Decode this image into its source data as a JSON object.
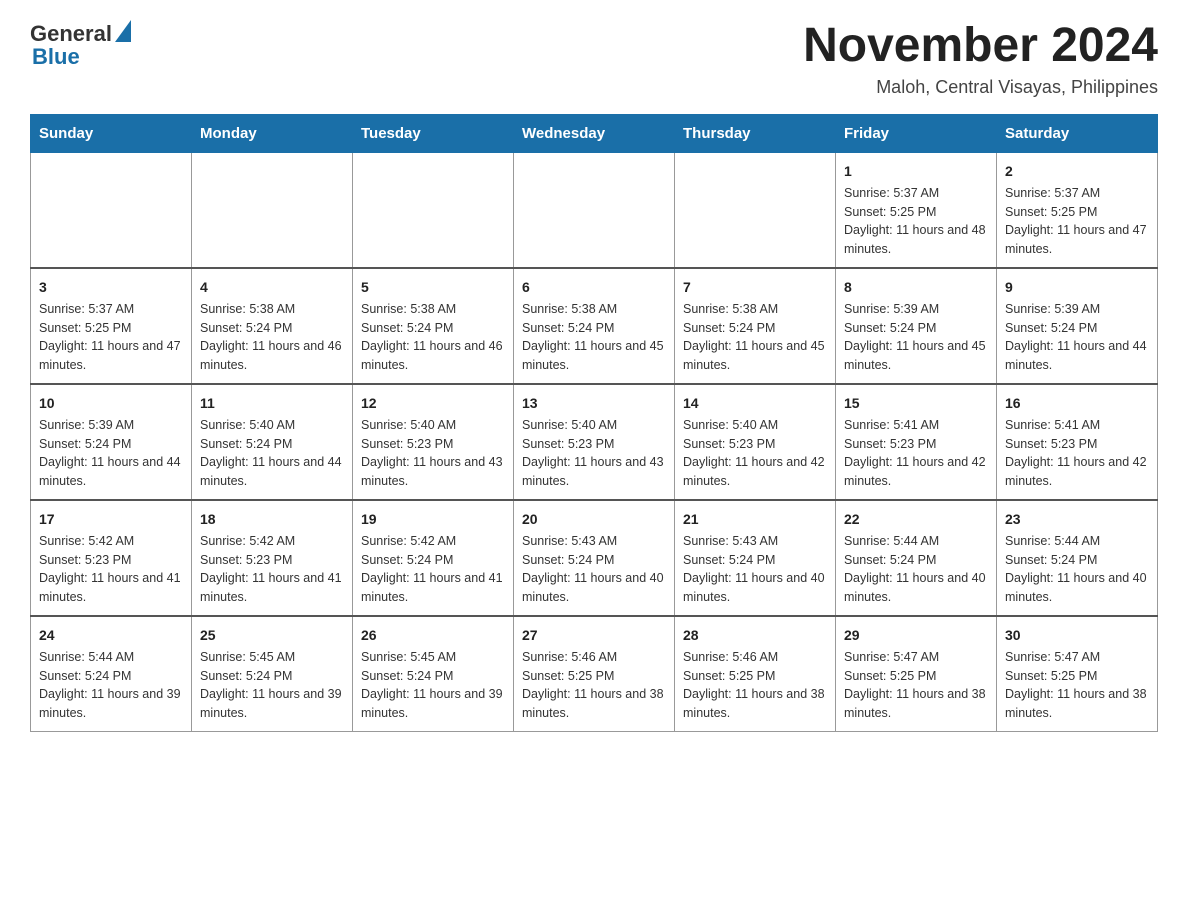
{
  "logo": {
    "general": "General",
    "blue": "Blue"
  },
  "title": "November 2024",
  "location": "Maloh, Central Visayas, Philippines",
  "days_of_week": [
    "Sunday",
    "Monday",
    "Tuesday",
    "Wednesday",
    "Thursday",
    "Friday",
    "Saturday"
  ],
  "weeks": [
    [
      {
        "day": "",
        "sunrise": "",
        "sunset": "",
        "daylight": ""
      },
      {
        "day": "",
        "sunrise": "",
        "sunset": "",
        "daylight": ""
      },
      {
        "day": "",
        "sunrise": "",
        "sunset": "",
        "daylight": ""
      },
      {
        "day": "",
        "sunrise": "",
        "sunset": "",
        "daylight": ""
      },
      {
        "day": "",
        "sunrise": "",
        "sunset": "",
        "daylight": ""
      },
      {
        "day": "1",
        "sunrise": "Sunrise: 5:37 AM",
        "sunset": "Sunset: 5:25 PM",
        "daylight": "Daylight: 11 hours and 48 minutes."
      },
      {
        "day": "2",
        "sunrise": "Sunrise: 5:37 AM",
        "sunset": "Sunset: 5:25 PM",
        "daylight": "Daylight: 11 hours and 47 minutes."
      }
    ],
    [
      {
        "day": "3",
        "sunrise": "Sunrise: 5:37 AM",
        "sunset": "Sunset: 5:25 PM",
        "daylight": "Daylight: 11 hours and 47 minutes."
      },
      {
        "day": "4",
        "sunrise": "Sunrise: 5:38 AM",
        "sunset": "Sunset: 5:24 PM",
        "daylight": "Daylight: 11 hours and 46 minutes."
      },
      {
        "day": "5",
        "sunrise": "Sunrise: 5:38 AM",
        "sunset": "Sunset: 5:24 PM",
        "daylight": "Daylight: 11 hours and 46 minutes."
      },
      {
        "day": "6",
        "sunrise": "Sunrise: 5:38 AM",
        "sunset": "Sunset: 5:24 PM",
        "daylight": "Daylight: 11 hours and 45 minutes."
      },
      {
        "day": "7",
        "sunrise": "Sunrise: 5:38 AM",
        "sunset": "Sunset: 5:24 PM",
        "daylight": "Daylight: 11 hours and 45 minutes."
      },
      {
        "day": "8",
        "sunrise": "Sunrise: 5:39 AM",
        "sunset": "Sunset: 5:24 PM",
        "daylight": "Daylight: 11 hours and 45 minutes."
      },
      {
        "day": "9",
        "sunrise": "Sunrise: 5:39 AM",
        "sunset": "Sunset: 5:24 PM",
        "daylight": "Daylight: 11 hours and 44 minutes."
      }
    ],
    [
      {
        "day": "10",
        "sunrise": "Sunrise: 5:39 AM",
        "sunset": "Sunset: 5:24 PM",
        "daylight": "Daylight: 11 hours and 44 minutes."
      },
      {
        "day": "11",
        "sunrise": "Sunrise: 5:40 AM",
        "sunset": "Sunset: 5:24 PM",
        "daylight": "Daylight: 11 hours and 44 minutes."
      },
      {
        "day": "12",
        "sunrise": "Sunrise: 5:40 AM",
        "sunset": "Sunset: 5:23 PM",
        "daylight": "Daylight: 11 hours and 43 minutes."
      },
      {
        "day": "13",
        "sunrise": "Sunrise: 5:40 AM",
        "sunset": "Sunset: 5:23 PM",
        "daylight": "Daylight: 11 hours and 43 minutes."
      },
      {
        "day": "14",
        "sunrise": "Sunrise: 5:40 AM",
        "sunset": "Sunset: 5:23 PM",
        "daylight": "Daylight: 11 hours and 42 minutes."
      },
      {
        "day": "15",
        "sunrise": "Sunrise: 5:41 AM",
        "sunset": "Sunset: 5:23 PM",
        "daylight": "Daylight: 11 hours and 42 minutes."
      },
      {
        "day": "16",
        "sunrise": "Sunrise: 5:41 AM",
        "sunset": "Sunset: 5:23 PM",
        "daylight": "Daylight: 11 hours and 42 minutes."
      }
    ],
    [
      {
        "day": "17",
        "sunrise": "Sunrise: 5:42 AM",
        "sunset": "Sunset: 5:23 PM",
        "daylight": "Daylight: 11 hours and 41 minutes."
      },
      {
        "day": "18",
        "sunrise": "Sunrise: 5:42 AM",
        "sunset": "Sunset: 5:23 PM",
        "daylight": "Daylight: 11 hours and 41 minutes."
      },
      {
        "day": "19",
        "sunrise": "Sunrise: 5:42 AM",
        "sunset": "Sunset: 5:24 PM",
        "daylight": "Daylight: 11 hours and 41 minutes."
      },
      {
        "day": "20",
        "sunrise": "Sunrise: 5:43 AM",
        "sunset": "Sunset: 5:24 PM",
        "daylight": "Daylight: 11 hours and 40 minutes."
      },
      {
        "day": "21",
        "sunrise": "Sunrise: 5:43 AM",
        "sunset": "Sunset: 5:24 PM",
        "daylight": "Daylight: 11 hours and 40 minutes."
      },
      {
        "day": "22",
        "sunrise": "Sunrise: 5:44 AM",
        "sunset": "Sunset: 5:24 PM",
        "daylight": "Daylight: 11 hours and 40 minutes."
      },
      {
        "day": "23",
        "sunrise": "Sunrise: 5:44 AM",
        "sunset": "Sunset: 5:24 PM",
        "daylight": "Daylight: 11 hours and 40 minutes."
      }
    ],
    [
      {
        "day": "24",
        "sunrise": "Sunrise: 5:44 AM",
        "sunset": "Sunset: 5:24 PM",
        "daylight": "Daylight: 11 hours and 39 minutes."
      },
      {
        "day": "25",
        "sunrise": "Sunrise: 5:45 AM",
        "sunset": "Sunset: 5:24 PM",
        "daylight": "Daylight: 11 hours and 39 minutes."
      },
      {
        "day": "26",
        "sunrise": "Sunrise: 5:45 AM",
        "sunset": "Sunset: 5:24 PM",
        "daylight": "Daylight: 11 hours and 39 minutes."
      },
      {
        "day": "27",
        "sunrise": "Sunrise: 5:46 AM",
        "sunset": "Sunset: 5:25 PM",
        "daylight": "Daylight: 11 hours and 38 minutes."
      },
      {
        "day": "28",
        "sunrise": "Sunrise: 5:46 AM",
        "sunset": "Sunset: 5:25 PM",
        "daylight": "Daylight: 11 hours and 38 minutes."
      },
      {
        "day": "29",
        "sunrise": "Sunrise: 5:47 AM",
        "sunset": "Sunset: 5:25 PM",
        "daylight": "Daylight: 11 hours and 38 minutes."
      },
      {
        "day": "30",
        "sunrise": "Sunrise: 5:47 AM",
        "sunset": "Sunset: 5:25 PM",
        "daylight": "Daylight: 11 hours and 38 minutes."
      }
    ]
  ]
}
